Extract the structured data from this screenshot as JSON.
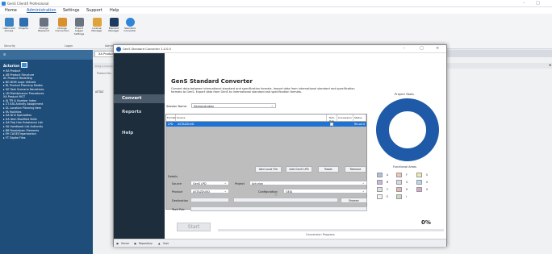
{
  "app": {
    "title": "GenS ClientX Professional",
    "minimize": "–",
    "maximize": "□"
  },
  "menu": [
    "Home",
    "Administration",
    "Settings",
    "Support",
    "Help"
  ],
  "ribbon": {
    "buttons": [
      {
        "label": "Users and Groups",
        "color": "#3b82c4"
      },
      {
        "label": "Projects",
        "color": "#2f6fb0"
      },
      {
        "label": "Change Password",
        "color": "#6b7280"
      },
      {
        "label": "Change Connection",
        "color": "#d9912f"
      },
      {
        "label": "Export Logger Settings",
        "color": "#6b7280"
      },
      {
        "label": "License Manager",
        "color": "#e0a23a"
      },
      {
        "label": "Element Manager",
        "color": "#1e3a5f"
      },
      {
        "label": "Standard Converter",
        "color": "#2f86d6"
      }
    ],
    "groups": [
      "Security",
      "Logon",
      "Administration"
    ]
  },
  "sidebar": {
    "header": "Acturion",
    "items": [
      "▾ XA Product",
      "  ▸ XB Product Structure",
      "    XC Product Modelling",
      "  ▸ BG BOM Logic Utilised",
      "  ▸ BL Product Planning Modes",
      "  ▸ GE Task Scenario Narratives",
      "  ▸ LM Maintenance Procedures",
      "    XA Product MCT",
      "  ▸ XJ TPI & Number Index",
      "▸ CT ATA Activity Assignment",
      "▸ GL Location Planning Item",
      "▸ FA Facilities",
      "▸ GA Drill Specialties",
      "▸ HA Item Modified Skills",
      "▸ GA Proj Han Substance List",
      "▸ VA Handbook List Authority",
      "▸ BB Breakdown Elements",
      "▸ EH CAGE/Organisation",
      "▸ YT Digital Files"
    ]
  },
  "main": {
    "tab": "XA Product",
    "grid_hint": "Drag a column header here to group by that column",
    "col_hdr": "Product Nu..",
    "row_code": "ASTAZ"
  },
  "dialog": {
    "title": "GenS Standard Converter 1.0.0.0",
    "nav": [
      "Convert",
      "Reports",
      "Help"
    ],
    "heading": "GenS Standard Converter",
    "description": "Convert data between international standard and specification formats. Import data from international standard and specification formats to GenS. Export data from GenS to international standard and specification formats.",
    "session_label": "Session Name:",
    "session_value": "Demonstration",
    "columns": [
      "Format",
      "Source",
      "Tech Pub",
      "Conversion",
      "Status"
    ],
    "rows": [
      {
        "format": "LPD",
        "source": "ASTAZDUXD",
        "techpub": "",
        "conversion": "",
        "status": "Re-sol'd"
      }
    ],
    "buttons": [
      "Add Local File",
      "Add GenS LPD",
      "Reset",
      "Remove"
    ],
    "details_label": "Details",
    "fields": {
      "source_label": "Source",
      "source_value": "GenS LPD",
      "project_label": "Project",
      "project_value": "Acturion",
      "product_label": "Product",
      "product_value": "ASTAZDUXD",
      "configuration_label": "Configuration",
      "configuration_value": "GEIA",
      "destination_label": "Destination",
      "destination_value": "",
      "browse": "Browse",
      "techpub_label": "Tech Pub",
      "techpub_value": ""
    },
    "start": "Start",
    "progress_label": "Conversion Progress",
    "progress_pct": "0%",
    "progress_value": 0,
    "project_stats": "Project Stats",
    "functional_areas": "Functional Areas",
    "legend": [
      {
        "k": "A",
        "c": "#a9c0de"
      },
      {
        "k": "F",
        "c": "#f3c2b3"
      },
      {
        "k": "S",
        "c": "#f0e9a8"
      },
      {
        "k": "B",
        "c": "#c8b6de"
      },
      {
        "k": "G",
        "c": "#d3dbe7"
      },
      {
        "k": "U",
        "c": "#b8d7ef"
      },
      {
        "k": "C",
        "c": "#e0e0e0"
      },
      {
        "k": "H",
        "c": "#e5b4b4"
      },
      {
        "k": "X",
        "c": "#d8a8c8"
      },
      {
        "k": "E",
        "c": "#f2f2f2"
      },
      {
        "k": "I",
        "c": "#c7dcb4"
      }
    ],
    "footer": [
      "Server",
      "Repository",
      "User"
    ],
    "donut_color": "#1e5aa8"
  }
}
